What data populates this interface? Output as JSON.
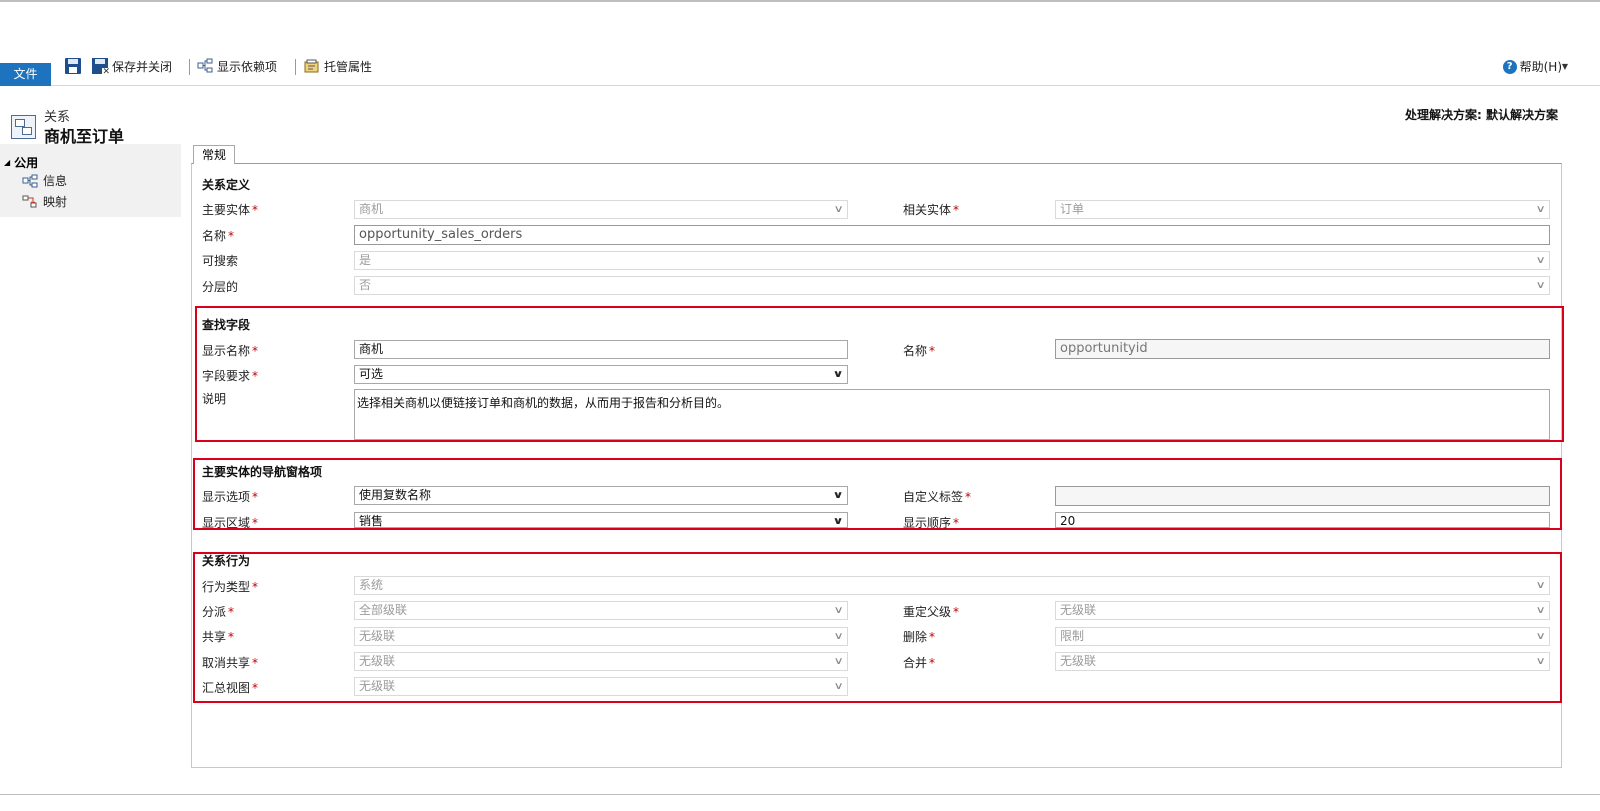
{
  "ribbon": {
    "file": "文件",
    "save_close": "保存并关闭",
    "show_dependencies": "显示依赖项",
    "managed_properties": "托管属性",
    "help": "帮助(H)"
  },
  "header": {
    "subtitle": "关系",
    "title": "商机至订单",
    "solution": "处理解决方案: 默认解决方案"
  },
  "nav": {
    "group": "公用",
    "items": [
      {
        "label": "信息",
        "icon": "relationship-info-icon"
      },
      {
        "label": "映射",
        "icon": "mapping-icon"
      }
    ]
  },
  "tabs": [
    {
      "label": "常规"
    }
  ],
  "relationship_definition": {
    "title": "关系定义",
    "primary_entity_label": "主要实体",
    "primary_entity_value": "商机",
    "related_entity_label": "相关实体",
    "related_entity_value": "订单",
    "name_label": "名称",
    "name_value": "opportunity_sales_orders",
    "searchable_label": "可搜索",
    "searchable_value": "是",
    "hierarchical_label": "分层的",
    "hierarchical_value": "否"
  },
  "lookup_field": {
    "title": "查找字段",
    "display_name_label": "显示名称",
    "display_name_value": "商机",
    "name_label": "名称",
    "name_value": "opportunityid",
    "requirement_label": "字段要求",
    "requirement_value": "可选",
    "description_label": "说明",
    "description_value": "选择相关商机以便链接订单和商机的数据，从而用于报告和分析目的。"
  },
  "navigation_pane": {
    "title": "主要实体的导航窗格项",
    "display_option_label": "显示选项",
    "display_option_value": "使用复数名称",
    "custom_label_label": "自定义标签",
    "custom_label_value": "",
    "display_area_label": "显示区域",
    "display_area_value": "销售",
    "display_order_label": "显示顺序",
    "display_order_value": "20"
  },
  "behavior": {
    "title": "关系行为",
    "type_label": "行为类型",
    "type_value": "系统",
    "assign_label": "分派",
    "assign_value": "全部级联",
    "reparent_label": "重定父级",
    "reparent_value": "无级联",
    "share_label": "共享",
    "share_value": "无级联",
    "delete_label": "删除",
    "delete_value": "限制",
    "unshare_label": "取消共享",
    "unshare_value": "无级联",
    "merge_label": "合并",
    "merge_value": "无级联",
    "rollup_label": "汇总视图",
    "rollup_value": "无级联"
  },
  "colors": {
    "file_button": "#1e73be",
    "required": "#c00000",
    "highlight_box": "#d9001b"
  }
}
